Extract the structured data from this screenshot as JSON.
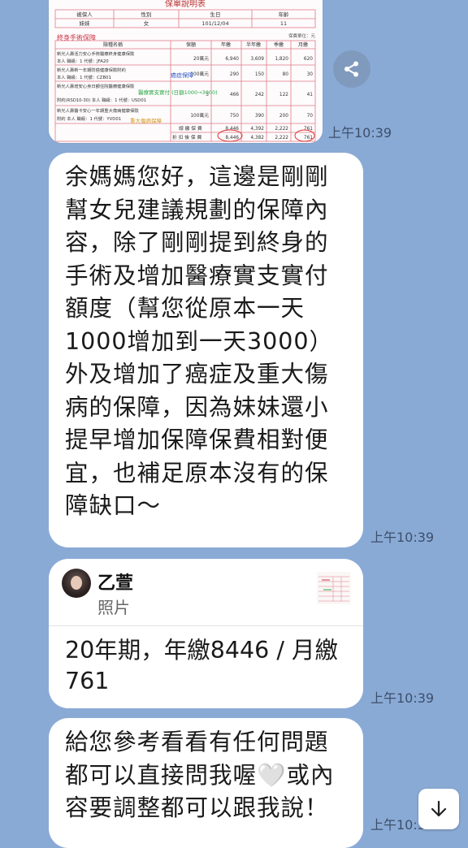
{
  "image_message": {
    "doc_title": "保單說明表",
    "header_cols": [
      "被保人",
      "性別",
      "生日",
      "年齡"
    ],
    "header_vals": [
      "妹妹",
      "女",
      "101/12/04",
      "11"
    ],
    "unit_note": "保費單位：元",
    "table_cols": [
      "險種名稱",
      "保額",
      "年繳",
      "半年繳",
      "季繳",
      "月繳"
    ],
    "rows": [
      {
        "name": "新光人壽活力安心手術醫療終身健康保險",
        "sub": "本人 職級：1  代號：JFA20",
        "amount": "20萬元",
        "year": "6,940",
        "half": "3,609",
        "quarter": "1,820",
        "month": "620"
      },
      {
        "name": "新光人壽新一年期防癌健康保險附約",
        "sub": "本人 職級：1  代號：CZB01",
        "amount": "100萬元",
        "year": "290",
        "half": "150",
        "quarter": "80",
        "month": "30"
      },
      {
        "name": "新光人壽增安心身日額住院醫療健康保險",
        "sub": "附約(RSD10-30)  本人 職級：1 代號：USD01",
        "amount": "3",
        "year": "466",
        "half": "242",
        "quarter": "122",
        "month": "41"
      },
      {
        "name": "新光人壽醫卡安心一年期重大傷病健康保險",
        "sub": "附約  本人 職級：1  代號：YVD01",
        "amount": "100萬元",
        "year": "750",
        "half": "390",
        "quarter": "200",
        "month": "70"
      }
    ],
    "total_label": "總 繳 保 費",
    "total_vals": [
      "8,446",
      "4,392",
      "2,222",
      "761"
    ],
    "discount_label": "折 扣 後 保 費",
    "discount_vals": [
      "8,446",
      "4,382",
      "2,222",
      "761"
    ],
    "annot_1": "終身手術保障",
    "annot_2": "癌症保障",
    "annot_3": "醫療實支實付 (日額1000→3000)",
    "annot_4": "重大傷病保障",
    "timestamp": "上午10:39"
  },
  "messages": [
    {
      "text": "余媽媽您好，這邊是剛剛\n幫女兒建議規劃的保障內\n容，除了剛剛提到終身的\n手術及增加醫療實支實付\n額度（幫您從原本一天\n1000增加到一天3000）\n外及增加了癌症及重大傷\n病的保障，因為妹妹還小\n提早增加保障保費相對便\n宜，也補足原本沒有的保\n障缺口〜",
      "timestamp": "上午10:39"
    },
    {
      "reply_name": "乙萱",
      "reply_type": "照片",
      "text": "20年期，年繳8446 / 月繳\n761",
      "timestamp": "上午10:39"
    },
    {
      "text_before": "給您參考看看有任何問題\n都可以直接問我喔",
      "heart": "🤍",
      "text_after": "或內\n容要調整都可以跟我說！",
      "timestamp": "上午10:39"
    }
  ],
  "icons": {
    "share": "share-icon",
    "scroll_down": "arrow-down-icon"
  },
  "colors": {
    "chat_background": "#8aaad6",
    "bubble": "#ffffff",
    "sheet_border": "#e07a8a",
    "annotation_green": "#2ea84a"
  }
}
